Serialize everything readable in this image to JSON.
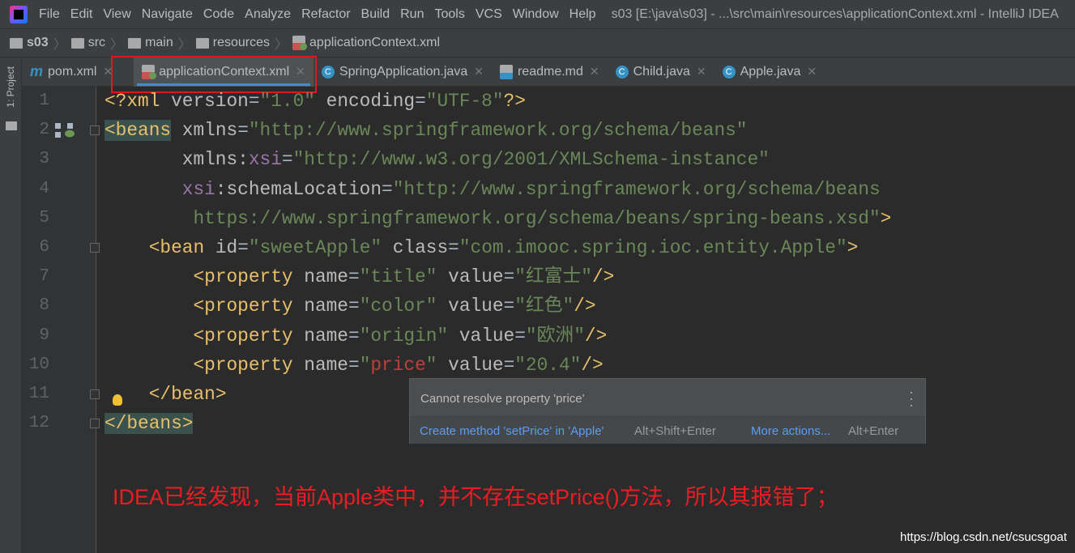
{
  "menubar": {
    "items": [
      "File",
      "Edit",
      "View",
      "Navigate",
      "Code",
      "Analyze",
      "Refactor",
      "Build",
      "Run",
      "Tools",
      "VCS",
      "Window",
      "Help"
    ],
    "title": "s03 [E:\\java\\s03] - ...\\src\\main\\resources\\applicationContext.xml - IntelliJ IDEA"
  },
  "breadcrumb": [
    "s03",
    "src",
    "main",
    "resources",
    "applicationContext.xml"
  ],
  "sidebar": {
    "project_tab": "1: Project"
  },
  "tabs": [
    {
      "label": "pom.xml",
      "icon": "maven-icon"
    },
    {
      "label": "applicationContext.xml",
      "icon": "spring-xml-icon",
      "active": true
    },
    {
      "label": "SpringApplication.java",
      "icon": "class-icon"
    },
    {
      "label": "readme.md",
      "icon": "markdown-icon"
    },
    {
      "label": "Child.java",
      "icon": "class-icon"
    },
    {
      "label": "Apple.java",
      "icon": "class-icon"
    }
  ],
  "code": [
    {
      "n": "1",
      "tokens": [
        [
          "tag",
          "<?xml "
        ],
        [
          "attr",
          "version"
        ],
        [
          "pl",
          "="
        ],
        [
          "val",
          "\"1.0\""
        ],
        [
          "pl",
          " "
        ],
        [
          "attr",
          "encoding"
        ],
        [
          "pl",
          "="
        ],
        [
          "val",
          "\"UTF-8\""
        ],
        [
          "tag",
          "?>"
        ]
      ]
    },
    {
      "n": "2",
      "tokens": [
        [
          "tag hl",
          "<beans"
        ],
        [
          "pl",
          " "
        ],
        [
          "attr",
          "xmlns"
        ],
        [
          "pl",
          "="
        ],
        [
          "val",
          "\"http://www.springframework.org/schema/beans\""
        ]
      ]
    },
    {
      "n": "3",
      "tokens": [
        [
          "pl",
          "       "
        ],
        [
          "attr",
          "xmlns:"
        ],
        [
          "ns",
          "xsi"
        ],
        [
          "pl",
          "="
        ],
        [
          "val",
          "\"http://www.w3.org/2001/XMLSchema-instance\""
        ]
      ]
    },
    {
      "n": "4",
      "tokens": [
        [
          "pl",
          "       "
        ],
        [
          "ns",
          "xsi"
        ],
        [
          "attr",
          ":schemaLocation"
        ],
        [
          "pl",
          "="
        ],
        [
          "val",
          "\"http://www.springframework.org/schema/beans"
        ]
      ]
    },
    {
      "n": "5",
      "tokens": [
        [
          "pl",
          "        "
        ],
        [
          "val",
          "https://www.springframework.org/schema/beans/spring-beans.xsd\""
        ],
        [
          "tag",
          ">"
        ]
      ]
    },
    {
      "n": "6",
      "tokens": [
        [
          "pl",
          "    "
        ],
        [
          "tag",
          "<bean "
        ],
        [
          "attr",
          "id"
        ],
        [
          "pl",
          "="
        ],
        [
          "val",
          "\"sweetApple\""
        ],
        [
          "pl",
          " "
        ],
        [
          "attr",
          "class"
        ],
        [
          "pl",
          "="
        ],
        [
          "val",
          "\"com.imooc.spring.ioc.entity.Apple\""
        ],
        [
          "tag",
          ">"
        ]
      ]
    },
    {
      "n": "7",
      "tokens": [
        [
          "pl",
          "        "
        ],
        [
          "tag",
          "<property "
        ],
        [
          "attr",
          "name"
        ],
        [
          "pl",
          "="
        ],
        [
          "val",
          "\"title\""
        ],
        [
          "pl",
          " "
        ],
        [
          "attr",
          "value"
        ],
        [
          "pl",
          "="
        ],
        [
          "val",
          "\"红富士\""
        ],
        [
          "tag",
          "/>"
        ]
      ]
    },
    {
      "n": "8",
      "tokens": [
        [
          "pl",
          "        "
        ],
        [
          "tag",
          "<property "
        ],
        [
          "attr",
          "name"
        ],
        [
          "pl",
          "="
        ],
        [
          "val",
          "\"color\""
        ],
        [
          "pl",
          " "
        ],
        [
          "attr",
          "value"
        ],
        [
          "pl",
          "="
        ],
        [
          "val",
          "\"红色\""
        ],
        [
          "tag",
          "/>"
        ]
      ]
    },
    {
      "n": "9",
      "tokens": [
        [
          "pl",
          "        "
        ],
        [
          "tag",
          "<property "
        ],
        [
          "attr",
          "name"
        ],
        [
          "pl",
          "="
        ],
        [
          "val",
          "\"origin\""
        ],
        [
          "pl",
          " "
        ],
        [
          "attr",
          "value"
        ],
        [
          "pl",
          "="
        ],
        [
          "val",
          "\"欧洲\""
        ],
        [
          "tag",
          "/>"
        ]
      ]
    },
    {
      "n": "10",
      "tokens": [
        [
          "pl",
          "        "
        ],
        [
          "tag",
          "<property "
        ],
        [
          "attr",
          "name"
        ],
        [
          "pl",
          "="
        ],
        [
          "val",
          "\""
        ],
        [
          "err",
          "price"
        ],
        [
          "val",
          "\""
        ],
        [
          "pl",
          " "
        ],
        [
          "attr",
          "value"
        ],
        [
          "pl",
          "="
        ],
        [
          "val",
          "\"20.4\""
        ],
        [
          "tag",
          "/>"
        ]
      ]
    },
    {
      "n": "11",
      "tokens": [
        [
          "pl",
          "    "
        ],
        [
          "tag",
          "</bean>"
        ]
      ]
    },
    {
      "n": "12",
      "tokens": [
        [
          "tag hl",
          "</beans>"
        ]
      ]
    }
  ],
  "popup": {
    "message": "Cannot resolve property 'price'",
    "action": "Create method 'setPrice' in 'Apple'",
    "action_shortcut": "Alt+Shift+Enter",
    "more": "More actions...",
    "more_shortcut": "Alt+Enter"
  },
  "annotation": "IDEA已经发现，当前Apple类中，并不存在setPrice()方法，所以其报错了；",
  "watermark": "https://blog.csdn.net/csucsgoat"
}
